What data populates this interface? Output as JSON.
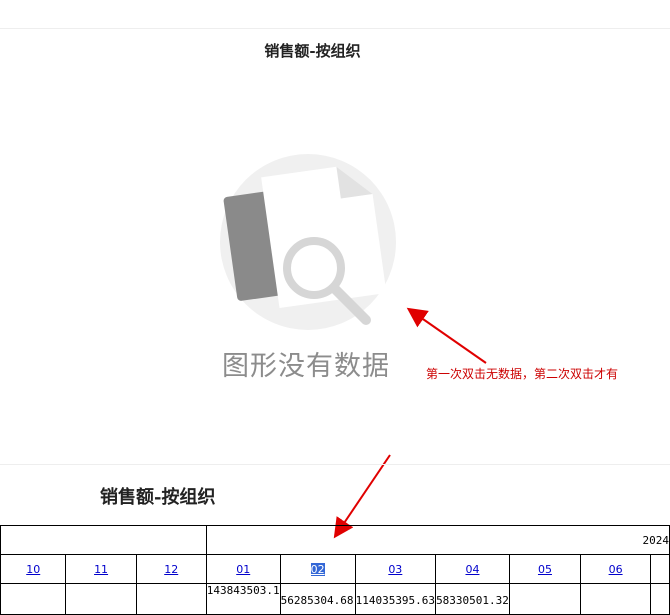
{
  "chart": {
    "title": "销售额-按组织",
    "no_data_text": "图形没有数据"
  },
  "annotation": {
    "text": "第一次双击无数据，第二次双击才有",
    "color": "#cc0000"
  },
  "report": {
    "title": "销售额-按组织",
    "year_label": "2024",
    "months": [
      "10",
      "11",
      "12",
      "01",
      "02",
      "03",
      "04",
      "05",
      "06"
    ],
    "selected_month": "02",
    "values": [
      "",
      "",
      "",
      "143843503.1",
      "56285304.68",
      "114035395.63",
      "58330501.32",
      "",
      ""
    ]
  }
}
